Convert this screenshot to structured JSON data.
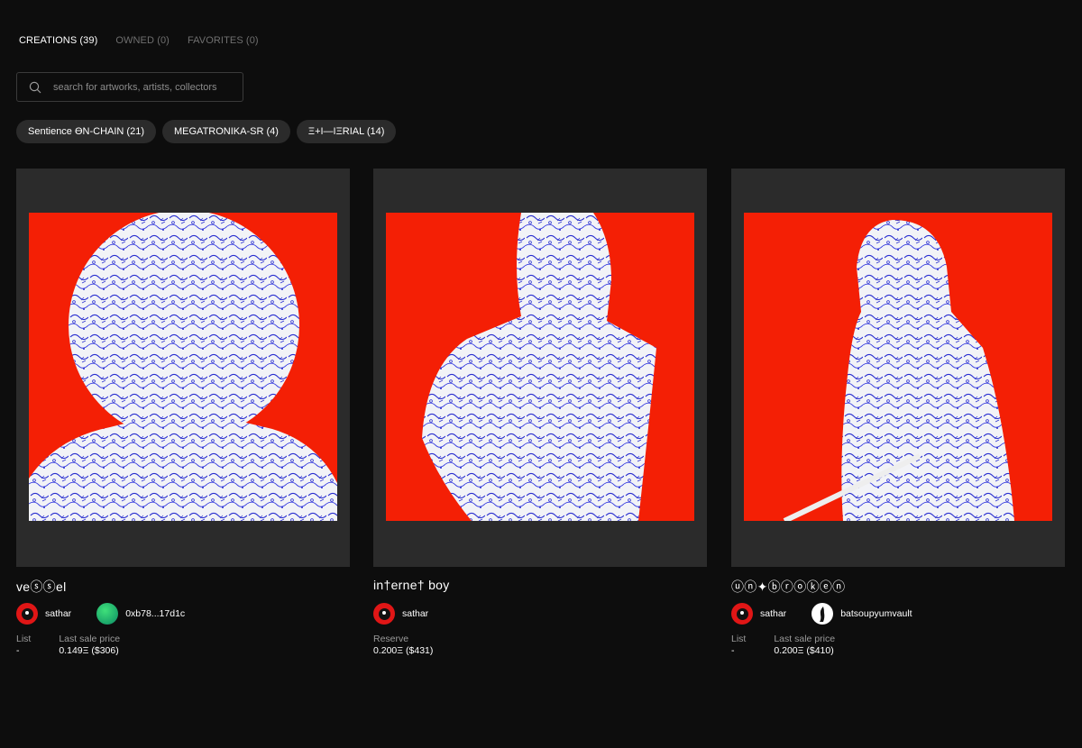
{
  "tabs": [
    {
      "label": "CREATIONS (39)",
      "active": true
    },
    {
      "label": "OWNED (0)",
      "active": false
    },
    {
      "label": "FAVORITES (0)",
      "active": false
    }
  ],
  "search": {
    "placeholder": "search for artworks, artists, collectors",
    "icon": "search-icon"
  },
  "collections": [
    {
      "label": "Sentience ƟN-CHAIN (21)"
    },
    {
      "label": "MEGATRONIKA-SR (4)"
    },
    {
      "label": "Ξ+I—IΞRIAL (14)"
    }
  ],
  "colors": {
    "background": "#0d0d0d",
    "card": "#2b2b2b",
    "art_background": "#f41f05",
    "pattern": "#2a2fd0"
  },
  "cards": [
    {
      "title": "veⓢⓢel",
      "creator": {
        "name": "sathar",
        "avatar": "red-skull-avatar"
      },
      "owner": {
        "name": "0xb78...17d1c",
        "avatar": "green-gradient-avatar"
      },
      "stats": [
        {
          "label": "List",
          "value": "-"
        },
        {
          "label": "Last sale price",
          "value": "0.149Ξ ($306)"
        }
      ]
    },
    {
      "title": "in†erne† boy",
      "creator": {
        "name": "sathar",
        "avatar": "red-skull-avatar"
      },
      "owner": null,
      "stats": [
        {
          "label": "Reserve",
          "value": "0.200Ξ ($431)"
        }
      ]
    },
    {
      "title": "ⓤⓝ✦ⓑⓡⓞⓚⓔⓝ",
      "creator": {
        "name": "sathar",
        "avatar": "red-skull-avatar"
      },
      "owner": {
        "name": "batsoupyumvault",
        "avatar": "white-silhouette-avatar"
      },
      "stats": [
        {
          "label": "List",
          "value": "-"
        },
        {
          "label": "Last sale price",
          "value": "0.200Ξ ($410)"
        }
      ]
    }
  ]
}
